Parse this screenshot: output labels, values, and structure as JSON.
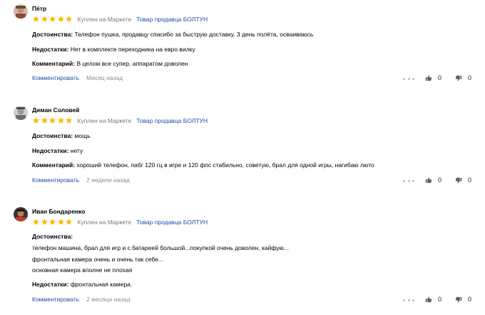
{
  "accent": {
    "star": "#ffb800",
    "link": "#1a4fa8"
  },
  "reviews": [
    {
      "author": "Пётр",
      "rating": 5,
      "purchase": "Куплен на Маркете",
      "seller": "Товар продавца БОЛТУН",
      "pros_label": "Достоинства:",
      "pros": "Телефон пушка, продавцу спасибо за быструю доставку. 3 день полёта, осваиваюсь",
      "cons_label": "Недостатки:",
      "cons": "Нет в комплекте переходника на евро вилку",
      "comment_label": "Комментарий:",
      "comment": "В целом все супер, аппаратом доволен",
      "reply": "Комментировать",
      "date": "Месяц назад",
      "likes": "0",
      "dislikes": "0"
    },
    {
      "author": "Диман Соловей",
      "rating": 5,
      "purchase": "Куплен на Маркете",
      "seller": "Товар продавца БОЛТУН",
      "pros_label": "Достоинства:",
      "pros": "мощь",
      "cons_label": "Недостатки:",
      "cons": "нету",
      "comment_label": "Комментарий:",
      "comment": "хороший телефон, пабг 120 гц в игре и 120 фпс стабильно, советую, брал для одной игры, нагибаю люто",
      "reply": "Комментировать",
      "date": "2 недели назад",
      "likes": "0",
      "dislikes": "0"
    },
    {
      "author": "Иван Бондаренко",
      "rating": 5,
      "purchase": "Куплен на Маркете",
      "seller": "Товар продавца БОЛТУН",
      "pros_label": "Достоинства:",
      "pros_lines": [
        "телефон машина, брал для игр и с батареей большой...покупкой очень доволен, кайфую...",
        "фронтальная камера очень и очень так себе...",
        "основная камера вполне не плохая"
      ],
      "cons_label": "Недостатки:",
      "cons": "фронтальная камера.",
      "reply": "Комментировать",
      "date": "2 месяца назад",
      "likes": "0",
      "dislikes": "0"
    }
  ]
}
